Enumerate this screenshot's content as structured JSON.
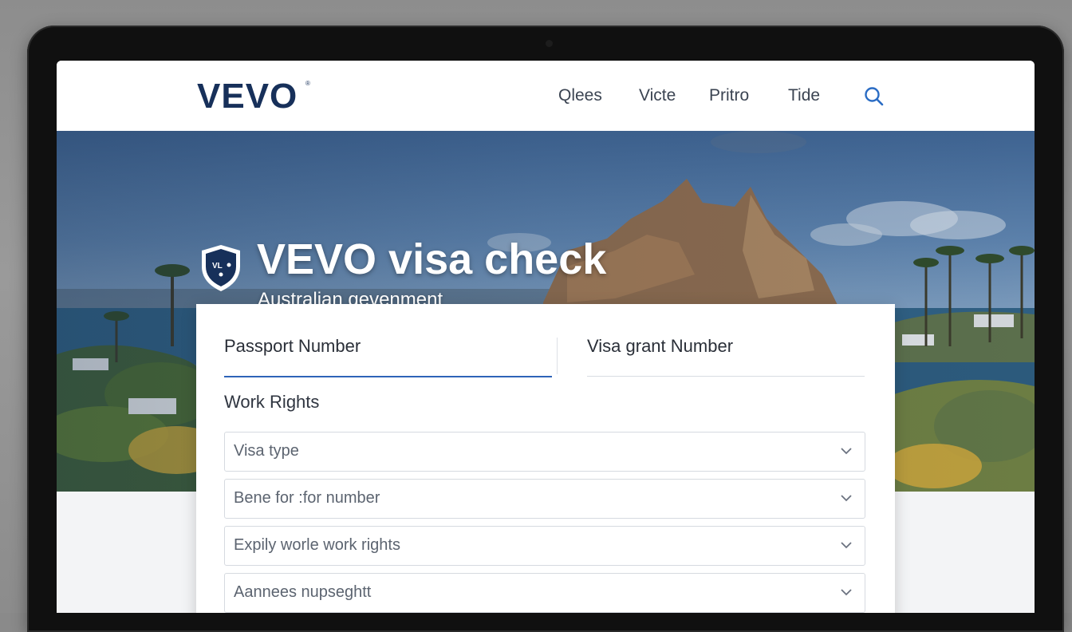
{
  "brand": {
    "logo_text": "VEVO",
    "logo_mark": "®"
  },
  "nav": {
    "items": [
      {
        "label": "Qlees"
      },
      {
        "label": "Victe"
      },
      {
        "label": "Pritro"
      },
      {
        "label": "Tide"
      }
    ],
    "search_icon": "search-icon"
  },
  "hero": {
    "title": "VEVO visa check",
    "subtitle": "Australian gevenment",
    "shield_text": "VL",
    "shield_icon": "shield-icon"
  },
  "form": {
    "tabs": [
      {
        "label": "Passport Number",
        "active": true
      },
      {
        "label": "Visa grant Number",
        "active": false
      }
    ],
    "section_label": "Work Rights",
    "selects": [
      {
        "placeholder": "Visa type"
      },
      {
        "placeholder": "Bene for :for number"
      },
      {
        "placeholder": "Expily worle work rights"
      },
      {
        "placeholder": "Aannees nupseghtt"
      }
    ]
  },
  "colors": {
    "brand_navy": "#17305a",
    "accent_blue": "#2e63b8",
    "search_blue": "#2a6cc4"
  }
}
